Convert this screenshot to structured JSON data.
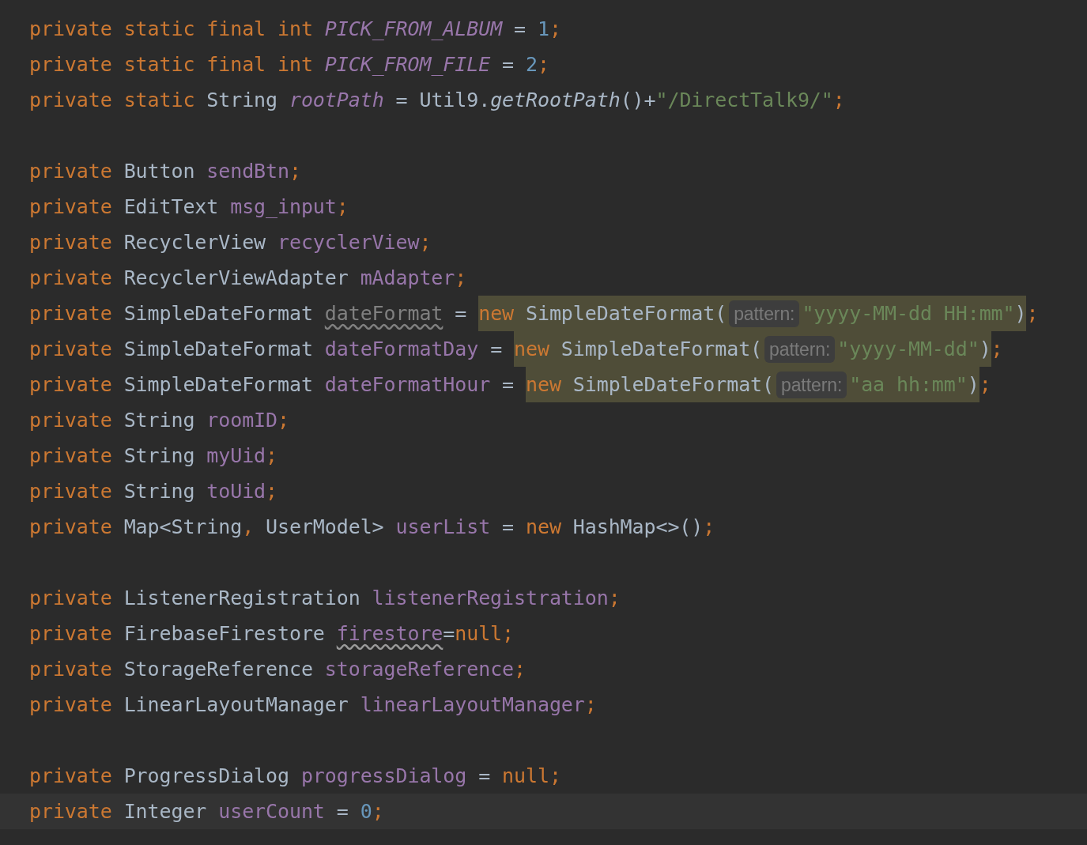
{
  "editor": {
    "lines": [
      {
        "kind": "code",
        "parts": [
          {
            "kind": "plain",
            "tokens": [
              {
                "kind": "kw",
                "text": "private"
              },
              {
                "kind": "kw",
                "text": " static"
              },
              {
                "kind": "kw",
                "text": " final"
              },
              {
                "kind": "kw",
                "text": " int"
              },
              {
                "kind": "static_field",
                "text": " PICK_FROM_ALBUM"
              },
              {
                "kind": "op",
                "text": " ="
              },
              {
                "kind": "num",
                "text": " 1"
              },
              {
                "kind": "punct",
                "text": ";"
              }
            ]
          }
        ]
      },
      {
        "kind": "code",
        "parts": [
          {
            "kind": "plain",
            "tokens": [
              {
                "kind": "kw",
                "text": "private"
              },
              {
                "kind": "kw",
                "text": " static"
              },
              {
                "kind": "kw",
                "text": " final"
              },
              {
                "kind": "kw",
                "text": " int"
              },
              {
                "kind": "static_field",
                "text": " PICK_FROM_FILE"
              },
              {
                "kind": "op",
                "text": " ="
              },
              {
                "kind": "num",
                "text": " 2"
              },
              {
                "kind": "punct",
                "text": ";"
              }
            ]
          }
        ]
      },
      {
        "kind": "code",
        "parts": [
          {
            "kind": "plain",
            "tokens": [
              {
                "kind": "kw",
                "text": "private"
              },
              {
                "kind": "kw",
                "text": " static"
              },
              {
                "kind": "type",
                "text": " String"
              },
              {
                "kind": "static_field",
                "text": " rootPath"
              },
              {
                "kind": "op",
                "text": " ="
              },
              {
                "kind": "type",
                "text": " Util9."
              },
              {
                "kind": "static_method",
                "text": "getRootPath"
              },
              {
                "kind": "op",
                "text": "()+"
              },
              {
                "kind": "str",
                "text": "\"/DirectTalk9/\""
              },
              {
                "kind": "punct",
                "text": ";"
              }
            ]
          }
        ]
      },
      {
        "kind": "blank"
      },
      {
        "kind": "code",
        "parts": [
          {
            "kind": "plain",
            "tokens": [
              {
                "kind": "kw",
                "text": "private"
              },
              {
                "kind": "type",
                "text": " Button"
              },
              {
                "kind": "field",
                "text": " sendBtn"
              },
              {
                "kind": "punct",
                "text": ";"
              }
            ]
          }
        ]
      },
      {
        "kind": "code",
        "parts": [
          {
            "kind": "plain",
            "tokens": [
              {
                "kind": "kw",
                "text": "private"
              },
              {
                "kind": "type",
                "text": " EditText"
              },
              {
                "kind": "field",
                "text": " msg_input"
              },
              {
                "kind": "punct",
                "text": ";"
              }
            ]
          }
        ]
      },
      {
        "kind": "code",
        "parts": [
          {
            "kind": "plain",
            "tokens": [
              {
                "kind": "kw",
                "text": "private"
              },
              {
                "kind": "type",
                "text": " RecyclerView"
              },
              {
                "kind": "field",
                "text": " recyclerView"
              },
              {
                "kind": "punct",
                "text": ";"
              }
            ]
          }
        ]
      },
      {
        "kind": "code",
        "parts": [
          {
            "kind": "plain",
            "tokens": [
              {
                "kind": "kw",
                "text": "private"
              },
              {
                "kind": "type",
                "text": " RecyclerViewAdapter"
              },
              {
                "kind": "field",
                "text": " mAdapter"
              },
              {
                "kind": "punct",
                "text": ";"
              }
            ]
          }
        ]
      },
      {
        "kind": "code",
        "parts": [
          {
            "kind": "plain",
            "tokens": [
              {
                "kind": "kw",
                "text": "private"
              },
              {
                "kind": "type",
                "text": " SimpleDateFormat"
              },
              {
                "kind": "unused_field",
                "text": " dateFormat"
              },
              {
                "kind": "op",
                "text": " = "
              }
            ]
          },
          {
            "kind": "highlight",
            "tokens": [
              {
                "kind": "kw",
                "text": "new"
              },
              {
                "kind": "type",
                "text": " SimpleDateFormat("
              },
              {
                "kind": "hint",
                "text": "pattern:"
              },
              {
                "kind": "str",
                "text": "\"yyyy-MM-dd HH:mm\""
              },
              {
                "kind": "op",
                "text": ")"
              }
            ]
          },
          {
            "kind": "plain",
            "tokens": [
              {
                "kind": "punct",
                "text": ";"
              }
            ]
          }
        ]
      },
      {
        "kind": "code",
        "parts": [
          {
            "kind": "plain",
            "tokens": [
              {
                "kind": "kw",
                "text": "private"
              },
              {
                "kind": "type",
                "text": " SimpleDateFormat"
              },
              {
                "kind": "field",
                "text": " dateFormatDay"
              },
              {
                "kind": "op",
                "text": " = "
              }
            ]
          },
          {
            "kind": "highlight",
            "tokens": [
              {
                "kind": "kw",
                "text": "new"
              },
              {
                "kind": "type",
                "text": " SimpleDateFormat("
              },
              {
                "kind": "hint",
                "text": "pattern:"
              },
              {
                "kind": "str",
                "text": "\"yyyy-MM-dd\""
              },
              {
                "kind": "op",
                "text": ")"
              }
            ]
          },
          {
            "kind": "plain",
            "tokens": [
              {
                "kind": "punct",
                "text": ";"
              }
            ]
          }
        ]
      },
      {
        "kind": "code",
        "parts": [
          {
            "kind": "plain",
            "tokens": [
              {
                "kind": "kw",
                "text": "private"
              },
              {
                "kind": "type",
                "text": " SimpleDateFormat"
              },
              {
                "kind": "field",
                "text": " dateFormatHour"
              },
              {
                "kind": "op",
                "text": " = "
              }
            ]
          },
          {
            "kind": "highlight",
            "tokens": [
              {
                "kind": "kw",
                "text": "new"
              },
              {
                "kind": "type",
                "text": " SimpleDateFormat("
              },
              {
                "kind": "hint",
                "text": "pattern:"
              },
              {
                "kind": "str",
                "text": "\"aa hh:mm\""
              },
              {
                "kind": "op",
                "text": ")"
              }
            ]
          },
          {
            "kind": "plain",
            "tokens": [
              {
                "kind": "punct",
                "text": ";"
              }
            ]
          }
        ]
      },
      {
        "kind": "code",
        "parts": [
          {
            "kind": "plain",
            "tokens": [
              {
                "kind": "kw",
                "text": "private"
              },
              {
                "kind": "type",
                "text": " String"
              },
              {
                "kind": "field",
                "text": " roomID"
              },
              {
                "kind": "punct",
                "text": ";"
              }
            ]
          }
        ]
      },
      {
        "kind": "code",
        "parts": [
          {
            "kind": "plain",
            "tokens": [
              {
                "kind": "kw",
                "text": "private"
              },
              {
                "kind": "type",
                "text": " String"
              },
              {
                "kind": "field",
                "text": " myUid"
              },
              {
                "kind": "punct",
                "text": ";"
              }
            ]
          }
        ]
      },
      {
        "kind": "code",
        "parts": [
          {
            "kind": "plain",
            "tokens": [
              {
                "kind": "kw",
                "text": "private"
              },
              {
                "kind": "type",
                "text": " String"
              },
              {
                "kind": "field",
                "text": " toUid"
              },
              {
                "kind": "punct",
                "text": ";"
              }
            ]
          }
        ]
      },
      {
        "kind": "code",
        "parts": [
          {
            "kind": "plain",
            "tokens": [
              {
                "kind": "kw",
                "text": "private"
              },
              {
                "kind": "type",
                "text": " Map<String"
              },
              {
                "kind": "punct",
                "text": ","
              },
              {
                "kind": "type",
                "text": " UserModel>"
              },
              {
                "kind": "field",
                "text": " userList"
              },
              {
                "kind": "op",
                "text": " ="
              },
              {
                "kind": "kw",
                "text": " new"
              },
              {
                "kind": "type",
                "text": " HashMap<>()"
              },
              {
                "kind": "punct",
                "text": ";"
              }
            ]
          }
        ]
      },
      {
        "kind": "blank"
      },
      {
        "kind": "code",
        "parts": [
          {
            "kind": "plain",
            "tokens": [
              {
                "kind": "kw",
                "text": "private"
              },
              {
                "kind": "type",
                "text": " ListenerRegistration"
              },
              {
                "kind": "field",
                "text": " listenerRegistration"
              },
              {
                "kind": "punct",
                "text": ";"
              }
            ]
          }
        ]
      },
      {
        "kind": "code",
        "parts": [
          {
            "kind": "plain",
            "tokens": [
              {
                "kind": "kw",
                "text": "private"
              },
              {
                "kind": "type",
                "text": " FirebaseFirestore"
              },
              {
                "kind": "warn_field",
                "text": " firestore"
              },
              {
                "kind": "op",
                "text": "="
              },
              {
                "kind": "kw",
                "text": "null"
              },
              {
                "kind": "punct",
                "text": ";"
              }
            ]
          }
        ]
      },
      {
        "kind": "code",
        "parts": [
          {
            "kind": "plain",
            "tokens": [
              {
                "kind": "kw",
                "text": "private"
              },
              {
                "kind": "type",
                "text": " StorageReference"
              },
              {
                "kind": "field",
                "text": " storageReference"
              },
              {
                "kind": "punct",
                "text": ";"
              }
            ]
          }
        ]
      },
      {
        "kind": "code",
        "parts": [
          {
            "kind": "plain",
            "tokens": [
              {
                "kind": "kw",
                "text": "private"
              },
              {
                "kind": "type",
                "text": " LinearLayoutManager"
              },
              {
                "kind": "field",
                "text": " linearLayoutManager"
              },
              {
                "kind": "punct",
                "text": ";"
              }
            ]
          }
        ]
      },
      {
        "kind": "blank"
      },
      {
        "kind": "code",
        "parts": [
          {
            "kind": "plain",
            "tokens": [
              {
                "kind": "kw",
                "text": "private"
              },
              {
                "kind": "type",
                "text": " ProgressDialog"
              },
              {
                "kind": "field",
                "text": " progressDialog"
              },
              {
                "kind": "op",
                "text": " ="
              },
              {
                "kind": "kw",
                "text": " null"
              },
              {
                "kind": "punct",
                "text": ";"
              }
            ]
          }
        ]
      },
      {
        "kind": "current_line",
        "parts": [
          {
            "kind": "plain",
            "tokens": [
              {
                "kind": "kw",
                "text": "private"
              },
              {
                "kind": "type",
                "text": " Integer"
              },
              {
                "kind": "field",
                "text": " userCount"
              },
              {
                "kind": "op",
                "text": " ="
              },
              {
                "kind": "num",
                "text": " 0"
              },
              {
                "kind": "punct",
                "text": ";"
              }
            ]
          }
        ]
      }
    ]
  }
}
